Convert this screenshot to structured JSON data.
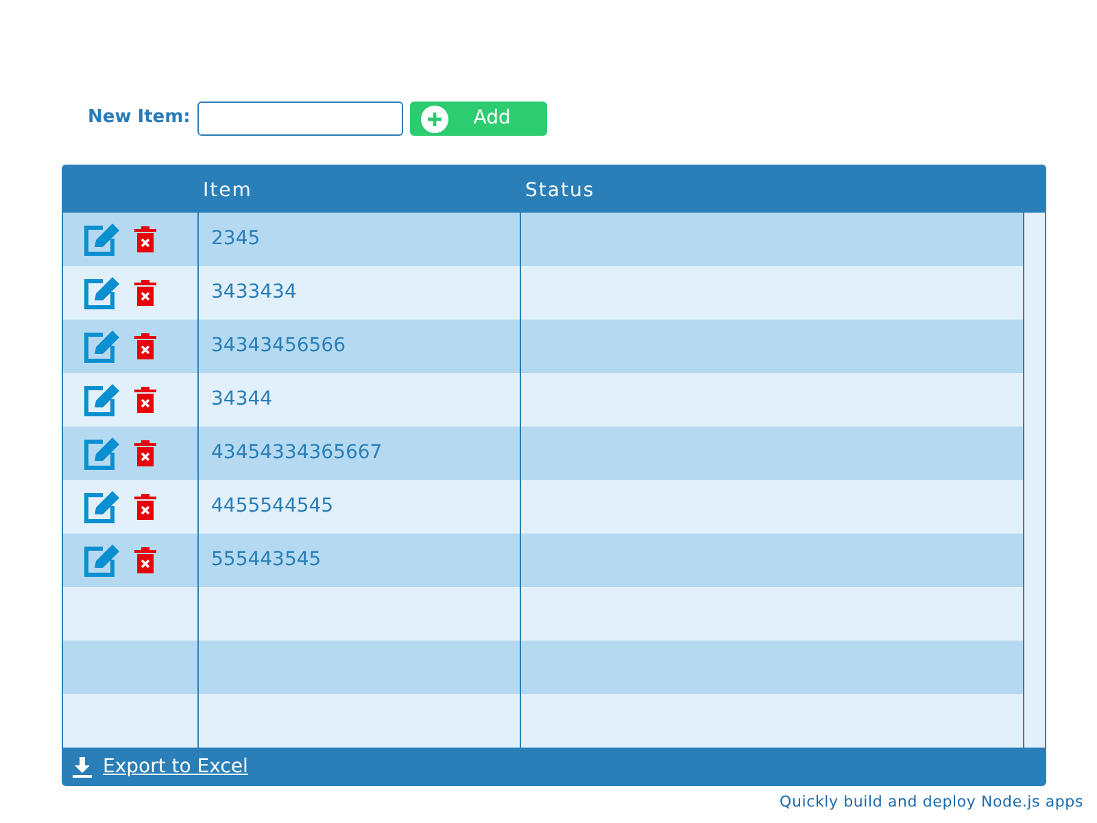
{
  "new_item": {
    "label": "New Item:",
    "button": "Add"
  },
  "table": {
    "columns": [
      "Item",
      "Status"
    ],
    "rows": [
      {
        "item": "2345"
      },
      {
        "item": "3433434"
      },
      {
        "item": "34343456566"
      },
      {
        "item": "34344"
      },
      {
        "item": "43454334365667"
      },
      {
        "item": "4455544545"
      },
      {
        "item": "555443545"
      }
    ],
    "footer_link": "Export to Excel"
  },
  "footer_text": "Quickly build and deploy Node.js apps"
}
